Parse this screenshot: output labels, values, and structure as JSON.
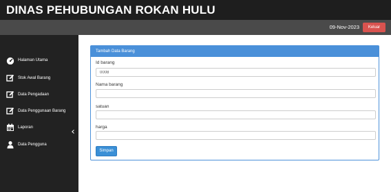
{
  "header": {
    "title": "DINAS PEHUBUNGAN ROKAN HULU"
  },
  "topnav": {
    "date": "09-Nov-2023",
    "logout_label": "Keluar"
  },
  "sidebar": {
    "items": [
      {
        "label": "Halaman Utama",
        "icon": "dashboard-icon"
      },
      {
        "label": "Stok Awal Barang",
        "icon": "edit-icon"
      },
      {
        "label": "Data Pengadaan",
        "icon": "edit-icon"
      },
      {
        "label": "Data Penggunaan Barang",
        "icon": "edit-icon"
      },
      {
        "label": "Laporan",
        "icon": "calendar-icon"
      },
      {
        "label": "Data Pengguna",
        "icon": "user-icon"
      }
    ]
  },
  "form": {
    "heading": "Tambah Data Barang",
    "fields": [
      {
        "label": "Id barang",
        "value": "0008"
      },
      {
        "label": "Nama barang",
        "value": ""
      },
      {
        "label": "satuan",
        "value": ""
      },
      {
        "label": "harga",
        "value": ""
      }
    ],
    "submit_label": "Simpan"
  },
  "colors": {
    "primary": "#4a90d9",
    "danger": "#d9534f",
    "sidebar": "#222222",
    "titlebar": "#1e1e1e",
    "navbar": "#4a4a4a"
  }
}
